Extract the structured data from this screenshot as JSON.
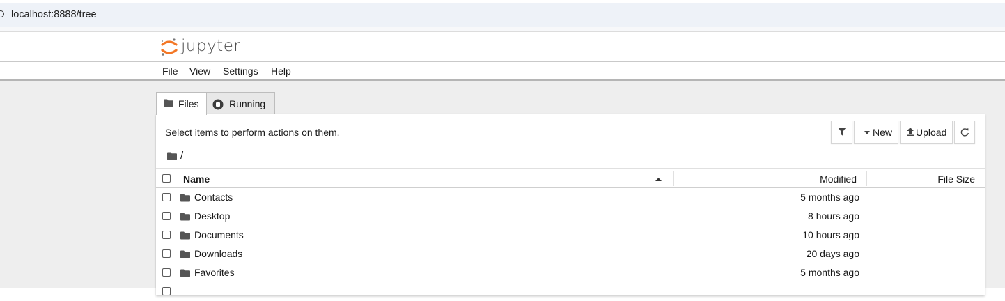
{
  "browser": {
    "url": "localhost:8888/tree"
  },
  "header": {
    "logo_text": "jupyter"
  },
  "menu": {
    "items": [
      "File",
      "View",
      "Settings",
      "Help"
    ]
  },
  "tabs": [
    {
      "label": "Files",
      "icon": "folder-icon",
      "active": true
    },
    {
      "label": "Running",
      "icon": "stop-circle-icon",
      "active": false
    }
  ],
  "toolbar": {
    "hint": "Select items to perform actions on them.",
    "filter_icon": "filter-icon",
    "new_label": "New",
    "upload_label": "Upload",
    "refresh_icon": "refresh-icon"
  },
  "breadcrumb": {
    "path": "/"
  },
  "list": {
    "columns": {
      "name": "Name",
      "modified": "Modified",
      "size": "File Size"
    },
    "sort": {
      "column": "Name",
      "direction": "ascending"
    },
    "rows": [
      {
        "name": "Contacts",
        "modified": "5 months ago",
        "size": ""
      },
      {
        "name": "Desktop",
        "modified": "8 hours ago",
        "size": ""
      },
      {
        "name": "Documents",
        "modified": "10 hours ago",
        "size": ""
      },
      {
        "name": "Downloads",
        "modified": "20 days ago",
        "size": ""
      },
      {
        "name": "Favorites",
        "modified": "5 months ago",
        "size": ""
      }
    ]
  },
  "colors": {
    "jupyter_orange": "#f37726",
    "page_background": "#eeeeee",
    "address_bar": "#eef2f8"
  }
}
